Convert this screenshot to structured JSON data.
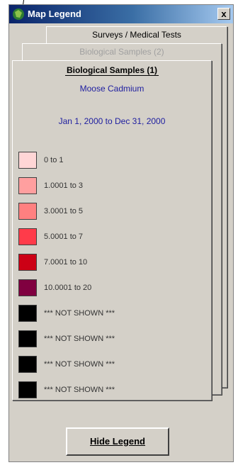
{
  "window": {
    "title": "Map Legend",
    "close_label": "x"
  },
  "tabs": {
    "back1": "Surveys / Medical Tests",
    "back2": "Biological Samples (2)",
    "front": "Biological Samples (1)"
  },
  "legend": {
    "subtitle": "Moose Cadmium",
    "date_range": "Jan 1, 2000 to Dec 31, 2000",
    "items": [
      {
        "label": "0 to 1",
        "color": "#ffd6d6"
      },
      {
        "label": "1.0001 to 3",
        "color": "#ff9f9f"
      },
      {
        "label": "3.0001 to 5",
        "color": "#ff8080"
      },
      {
        "label": "5.0001 to 7",
        "color": "#ff3b4a"
      },
      {
        "label": "7.0001 to 10",
        "color": "#cc0015"
      },
      {
        "label": "10.0001 to 20",
        "color": "#800040"
      },
      {
        "label": "*** NOT SHOWN ***",
        "color": "#000000"
      },
      {
        "label": "*** NOT SHOWN ***",
        "color": "#000000"
      },
      {
        "label": "*** NOT SHOWN ***",
        "color": "#000000"
      },
      {
        "label": "*** NOT SHOWN ***",
        "color": "#000000"
      }
    ]
  },
  "buttons": {
    "hide_legend": "Hide Legend"
  }
}
